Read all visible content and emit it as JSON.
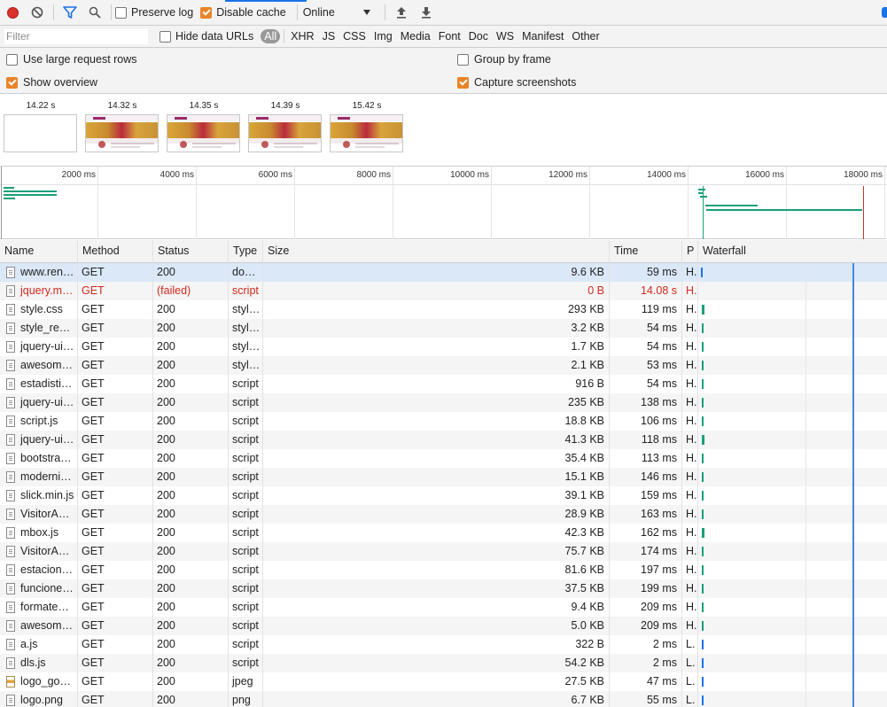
{
  "toolbar": {
    "preserve_log": "Preserve log",
    "preserve_log_checked": false,
    "disable_cache": "Disable cache",
    "disable_cache_checked": true,
    "throttle": "Online"
  },
  "filterbar": {
    "placeholder": "Filter",
    "hide_data_urls": "Hide data URLs",
    "types": [
      "All",
      "XHR",
      "JS",
      "CSS",
      "Img",
      "Media",
      "Font",
      "Doc",
      "WS",
      "Manifest",
      "Other"
    ],
    "active_type": "All"
  },
  "settings": {
    "large_rows": "Use large request rows",
    "group_by_frame": "Group by frame",
    "show_overview": "Show overview",
    "capture_screenshots": "Capture screenshots"
  },
  "filmstrip": [
    "14.22 s",
    "14.32 s",
    "14.35 s",
    "14.39 s",
    "15.42 s"
  ],
  "overview": {
    "ticks": [
      "2000 ms",
      "4000 ms",
      "6000 ms",
      "8000 ms",
      "10000 ms",
      "12000 ms",
      "14000 ms",
      "16000 ms",
      "18000 ms"
    ]
  },
  "table": {
    "columns": {
      "name": "Name",
      "method": "Method",
      "status": "Status",
      "type": "Type",
      "size": "Size",
      "time": "Time",
      "priority": "P",
      "waterfall": "Waterfall"
    },
    "rows": [
      {
        "name": "www.ren…",
        "method": "GET",
        "status": "200",
        "type": "do…",
        "size": "9.6 KB",
        "time": "59 ms",
        "p": "H.",
        "icon": "doc",
        "selected": true
      },
      {
        "name": "jquery.m…",
        "method": "GET",
        "status": "(failed)",
        "type": "script",
        "size": "0 B",
        "time": "14.08 s",
        "p": "H.",
        "icon": "doc",
        "failed": true
      },
      {
        "name": "style.css",
        "method": "GET",
        "status": "200",
        "type": "styl…",
        "size": "293 KB",
        "time": "119 ms",
        "p": "H.",
        "icon": "doc"
      },
      {
        "name": "style_re…",
        "method": "GET",
        "status": "200",
        "type": "styl…",
        "size": "3.2 KB",
        "time": "54 ms",
        "p": "H.",
        "icon": "doc"
      },
      {
        "name": "jquery-ui…",
        "method": "GET",
        "status": "200",
        "type": "styl…",
        "size": "1.7 KB",
        "time": "54 ms",
        "p": "H.",
        "icon": "doc"
      },
      {
        "name": "awesom…",
        "method": "GET",
        "status": "200",
        "type": "styl…",
        "size": "2.1 KB",
        "time": "53 ms",
        "p": "H.",
        "icon": "doc"
      },
      {
        "name": "estadisti…",
        "method": "GET",
        "status": "200",
        "type": "script",
        "size": "916 B",
        "time": "54 ms",
        "p": "H.",
        "icon": "doc"
      },
      {
        "name": "jquery-ui…",
        "method": "GET",
        "status": "200",
        "type": "script",
        "size": "235 KB",
        "time": "138 ms",
        "p": "H.",
        "icon": "doc"
      },
      {
        "name": "script.js",
        "method": "GET",
        "status": "200",
        "type": "script",
        "size": "18.8 KB",
        "time": "106 ms",
        "p": "H.",
        "icon": "doc"
      },
      {
        "name": "jquery-ui…",
        "method": "GET",
        "status": "200",
        "type": "script",
        "size": "41.3 KB",
        "time": "118 ms",
        "p": "H.",
        "icon": "doc"
      },
      {
        "name": "bootstra…",
        "method": "GET",
        "status": "200",
        "type": "script",
        "size": "35.4 KB",
        "time": "113 ms",
        "p": "H.",
        "icon": "doc"
      },
      {
        "name": "moderni…",
        "method": "GET",
        "status": "200",
        "type": "script",
        "size": "15.1 KB",
        "time": "146 ms",
        "p": "H.",
        "icon": "doc"
      },
      {
        "name": "slick.min.js",
        "method": "GET",
        "status": "200",
        "type": "script",
        "size": "39.1 KB",
        "time": "159 ms",
        "p": "H.",
        "icon": "doc"
      },
      {
        "name": "VisitorA…",
        "method": "GET",
        "status": "200",
        "type": "script",
        "size": "28.9 KB",
        "time": "163 ms",
        "p": "H.",
        "icon": "doc"
      },
      {
        "name": "mbox.js",
        "method": "GET",
        "status": "200",
        "type": "script",
        "size": "42.3 KB",
        "time": "162 ms",
        "p": "H.",
        "icon": "doc"
      },
      {
        "name": "VisitorA…",
        "method": "GET",
        "status": "200",
        "type": "script",
        "size": "75.7 KB",
        "time": "174 ms",
        "p": "H.",
        "icon": "doc"
      },
      {
        "name": "estacion…",
        "method": "GET",
        "status": "200",
        "type": "script",
        "size": "81.6 KB",
        "time": "197 ms",
        "p": "H.",
        "icon": "doc"
      },
      {
        "name": "funcione…",
        "method": "GET",
        "status": "200",
        "type": "script",
        "size": "37.5 KB",
        "time": "199 ms",
        "p": "H.",
        "icon": "doc"
      },
      {
        "name": "formate…",
        "method": "GET",
        "status": "200",
        "type": "script",
        "size": "9.4 KB",
        "time": "209 ms",
        "p": "H.",
        "icon": "doc"
      },
      {
        "name": "awesom…",
        "method": "GET",
        "status": "200",
        "type": "script",
        "size": "5.0 KB",
        "time": "209 ms",
        "p": "H.",
        "icon": "doc"
      },
      {
        "name": "a.js",
        "method": "GET",
        "status": "200",
        "type": "script",
        "size": "322 B",
        "time": "2 ms",
        "p": "L.",
        "icon": "doc"
      },
      {
        "name": "dls.js",
        "method": "GET",
        "status": "200",
        "type": "script",
        "size": "54.2 KB",
        "time": "2 ms",
        "p": "L.",
        "icon": "doc"
      },
      {
        "name": "logo_go…",
        "method": "GET",
        "status": "200",
        "type": "jpeg",
        "size": "27.5 KB",
        "time": "47 ms",
        "p": "L.",
        "icon": "img"
      },
      {
        "name": "logo.png",
        "method": "GET",
        "status": "200",
        "type": "png",
        "size": "6.7 KB",
        "time": "55 ms",
        "p": "L.",
        "icon": "doc"
      }
    ]
  }
}
